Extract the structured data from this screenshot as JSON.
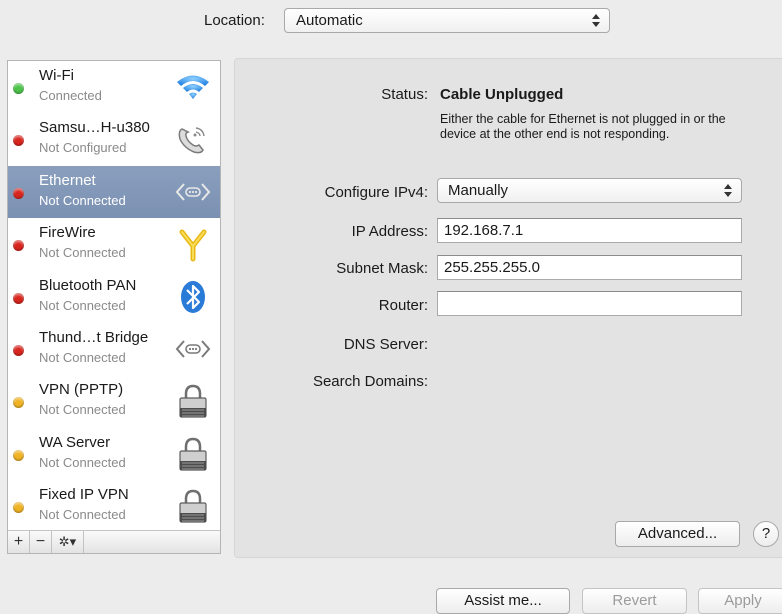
{
  "location": {
    "label": "Location:",
    "value": "Automatic"
  },
  "services": [
    {
      "name": "Wi-Fi",
      "status": "Connected",
      "dot": "green",
      "icon": "wifi-icon"
    },
    {
      "name": "Samsu…H-u380",
      "status": "Not Configured",
      "dot": "red",
      "icon": "phone-icon"
    },
    {
      "name": "Ethernet",
      "status": "Not Connected",
      "dot": "red",
      "icon": "ethernet-icon",
      "selected": true
    },
    {
      "name": "FireWire",
      "status": "Not Connected",
      "dot": "red",
      "icon": "firewire-icon"
    },
    {
      "name": "Bluetooth PAN",
      "status": "Not Connected",
      "dot": "red",
      "icon": "bluetooth-icon"
    },
    {
      "name": "Thund…t Bridge",
      "status": "Not Connected",
      "dot": "red",
      "icon": "bridge-icon"
    },
    {
      "name": "VPN (PPTP)",
      "status": "Not Connected",
      "dot": "yellow",
      "icon": "lock-icon"
    },
    {
      "name": "WA Server",
      "status": "Not Connected",
      "dot": "yellow",
      "icon": "lock-icon"
    },
    {
      "name": "Fixed IP VPN",
      "status": "Not Connected",
      "dot": "yellow",
      "icon": "lock-icon"
    }
  ],
  "toolbar": {
    "add": "+",
    "remove": "−",
    "gear": "✲▾"
  },
  "detail": {
    "status_label": "Status:",
    "status_value": "Cable Unplugged",
    "status_desc": "Either the cable for Ethernet is not plugged in or the device at the other end is not responding.",
    "configure_label": "Configure IPv4:",
    "configure_value": "Manually",
    "ip_label": "IP Address:",
    "ip_value": "192.168.7.1",
    "mask_label": "Subnet Mask:",
    "mask_value": "255.255.255.0",
    "router_label": "Router:",
    "router_value": "",
    "dns_label": "DNS Server:",
    "search_label": "Search Domains:",
    "advanced": "Advanced...",
    "help": "?"
  },
  "footer": {
    "assist": "Assist me...",
    "revert": "Revert",
    "apply": "Apply"
  },
  "colors": {
    "green": "#4cc34a",
    "red": "#d8261e",
    "yellow": "#f0b324",
    "selection": "#7b91b3"
  }
}
